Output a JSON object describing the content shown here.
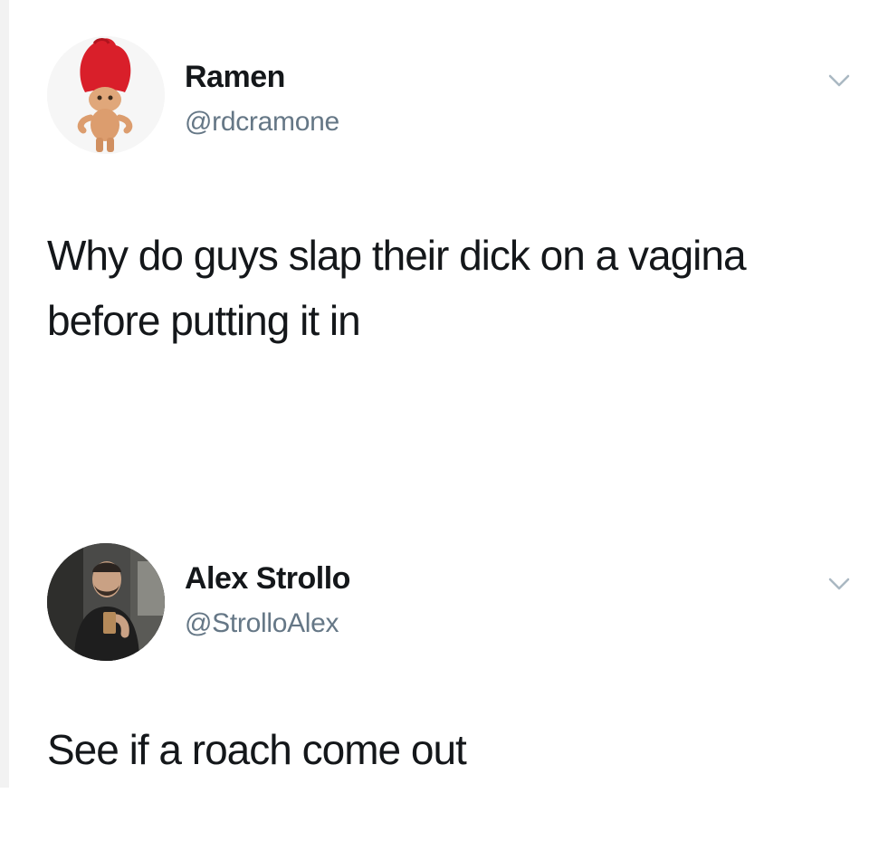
{
  "tweets": [
    {
      "name": "Ramen",
      "handle": "@rdcramone",
      "text_line_1": "Why do guys slap their dick on a vagina",
      "text_line_2": "before putting it in",
      "avatar_icon": "troll-doll-avatar",
      "menu_icon": "chevron-down-icon"
    },
    {
      "name": "Alex Strollo",
      "handle": "@StrolloAlex",
      "text_line_1": "See if a roach come out",
      "avatar_icon": "profile-photo-avatar",
      "menu_icon": "chevron-down-icon"
    }
  ],
  "colors": {
    "name": "#14171a",
    "handle": "#657786",
    "chevron": "#aab8c2",
    "troll_hair": "#d91f2a",
    "background": "#ffffff"
  }
}
